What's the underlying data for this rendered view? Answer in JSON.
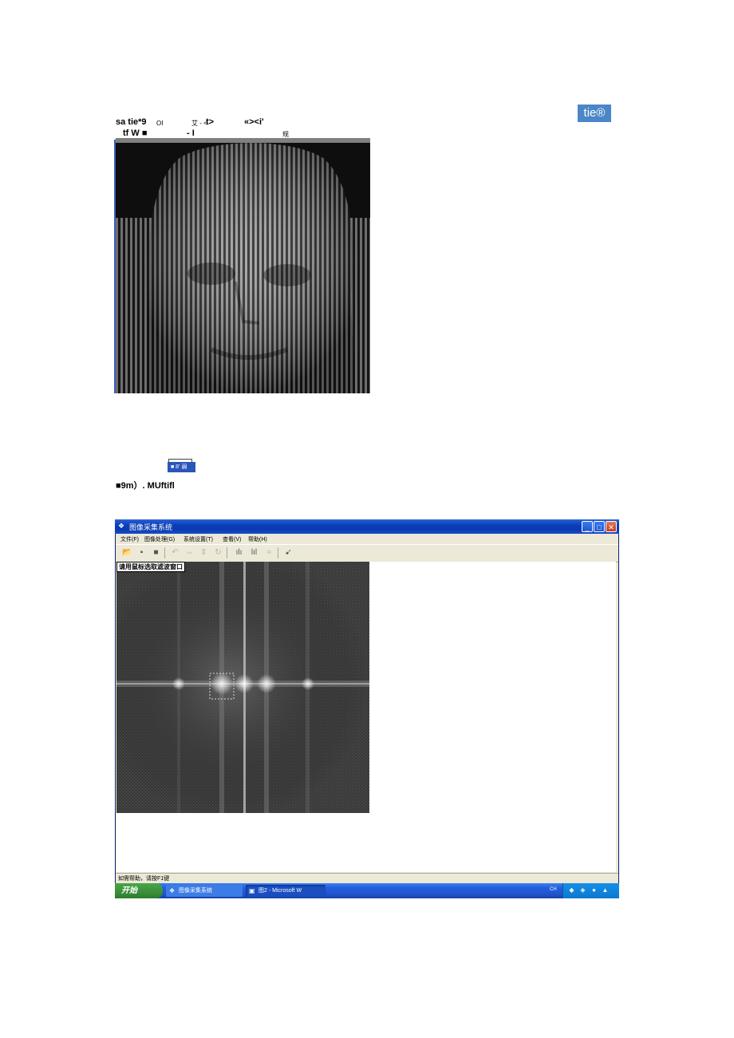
{
  "document": {
    "fragments": [
      "sa tie*9",
      "OI",
      "艾 - <",
      "t>",
      "«><i'",
      "tf W ■",
      "- I",
      "规"
    ],
    "badge": "tie®",
    "blue_bar_label": "■ 8' 弱",
    "caption": "■9m）. MUftifl"
  },
  "window": {
    "title": "图像采集系统",
    "menu": [
      "文件(F)",
      "图像处理(G)",
      "系统设置(T)",
      "查看(V)",
      "帮助(H)"
    ],
    "hint": "请用鼠标选取滤波窗口",
    "status": "如需帮助，请按F1键",
    "toolbar_icons": [
      "open-icon",
      "save-icon",
      "capture-icon",
      "undo-icon",
      "flip-horizontal-icon",
      "flip-vertical-icon",
      "rotate-icon",
      "histogram-icon",
      "histogram-equalize-icon",
      "filter-icon",
      "cursor-icon"
    ]
  },
  "taskbar": {
    "start_label": "开始",
    "tasks": [
      "图像采集系统",
      "图2 - Microsoft W"
    ],
    "lang": "CH"
  }
}
